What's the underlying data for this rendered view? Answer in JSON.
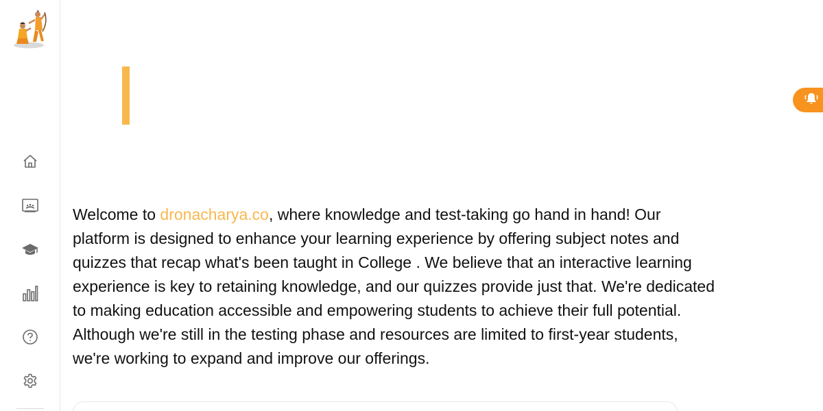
{
  "sidebar": {
    "logo": "dronacharya-logo",
    "items": [
      {
        "name": "home",
        "icon": "home-icon"
      },
      {
        "name": "board",
        "icon": "presentation-board-icon"
      },
      {
        "name": "courses",
        "icon": "graduation-cap-icon"
      },
      {
        "name": "stats",
        "icon": "bar-chart-icon"
      },
      {
        "name": "help",
        "icon": "help-circle-icon"
      },
      {
        "name": "settings",
        "icon": "gear-icon"
      }
    ]
  },
  "main": {
    "welcome_prefix": "Welcome to ",
    "site_link": "dronacharya.co",
    "welcome_rest": ", where knowledge and test-taking go hand in hand! Our platform is designed to enhance your learning experience by offering subject notes and quizzes that recap what's been taught in College . We believe that an interactive learning experience is key to retaining knowledge, and our quizzes provide just that. We're dedicated to making education accessible and empowering students to achieve their full potential. Although we're still in the testing phase and resources are limited to first-year students, we're working to expand and improve our offerings."
  },
  "notification": {
    "icon": "bell-ring-icon"
  },
  "colors": {
    "accent": "#f8b84e",
    "notify": "#f7931e",
    "icon": "#6b6b6b"
  }
}
